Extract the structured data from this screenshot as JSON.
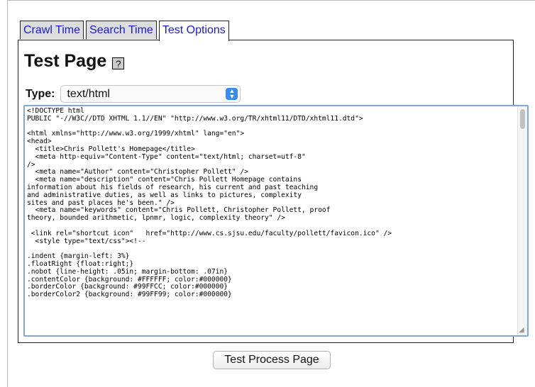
{
  "tabs": [
    "Crawl Time",
    "Search Time",
    "Test Options"
  ],
  "page": {
    "title": "Test Page",
    "help_label": "?",
    "type_label": "Type:",
    "type_value": "text/html",
    "code": "<!DOCTYPE html\nPUBLIC \"-//W3C//DTD XHTML 1.1//EN\" \"http://www.w3.org/TR/xhtml11/DTD/xhtml11.dtd\">\n\n<html xmlns=\"http://www.w3.org/1999/xhtml\" lang=\"en\">\n<head>\n  <title>Chris Pollett's Homepage</title>\n  <meta http-equiv=\"Content-Type\" content=\"text/html; charset=utf-8\"\n/>\n  <meta name=\"Author\" content=\"Christopher Pollett\" />\n  <meta name=\"description\" content=\"Chris Pollett Homepage contains\ninformation about his fields of research, his current and past teaching\nand administrative duties, as well as links to pictures, complexity\nsites and past places he's been.\" />\n  <meta name=\"keywords\" content=\"Chris Pollett, Christopher Pollett, proof\ntheory, bounded arithmetic, lpnmr, logic, complexity theory\" />\n\n <link rel=\"shortcut icon\"   href=\"http://www.cs.sjsu.edu/faculty/pollett/favicon.ico\" />\n  <style type=\"text/css\"><!--\n\n.indent {margin-left: 3%}\n.floatRight {float:right;}\n.nobot {line-height: .05in; margin-bottom: .07in}\n.contentColor {background: #FFFFFF; color:#000000}\n.borderColor {background: #99FFCC; color:#000000}\n.borderColor2 {background: #99FF99; color:#000000}",
    "button_label": "Test Process Page"
  },
  "icons": {
    "select_arrow": "chevron-updown-icon",
    "resize": "resize-grip-icon"
  }
}
